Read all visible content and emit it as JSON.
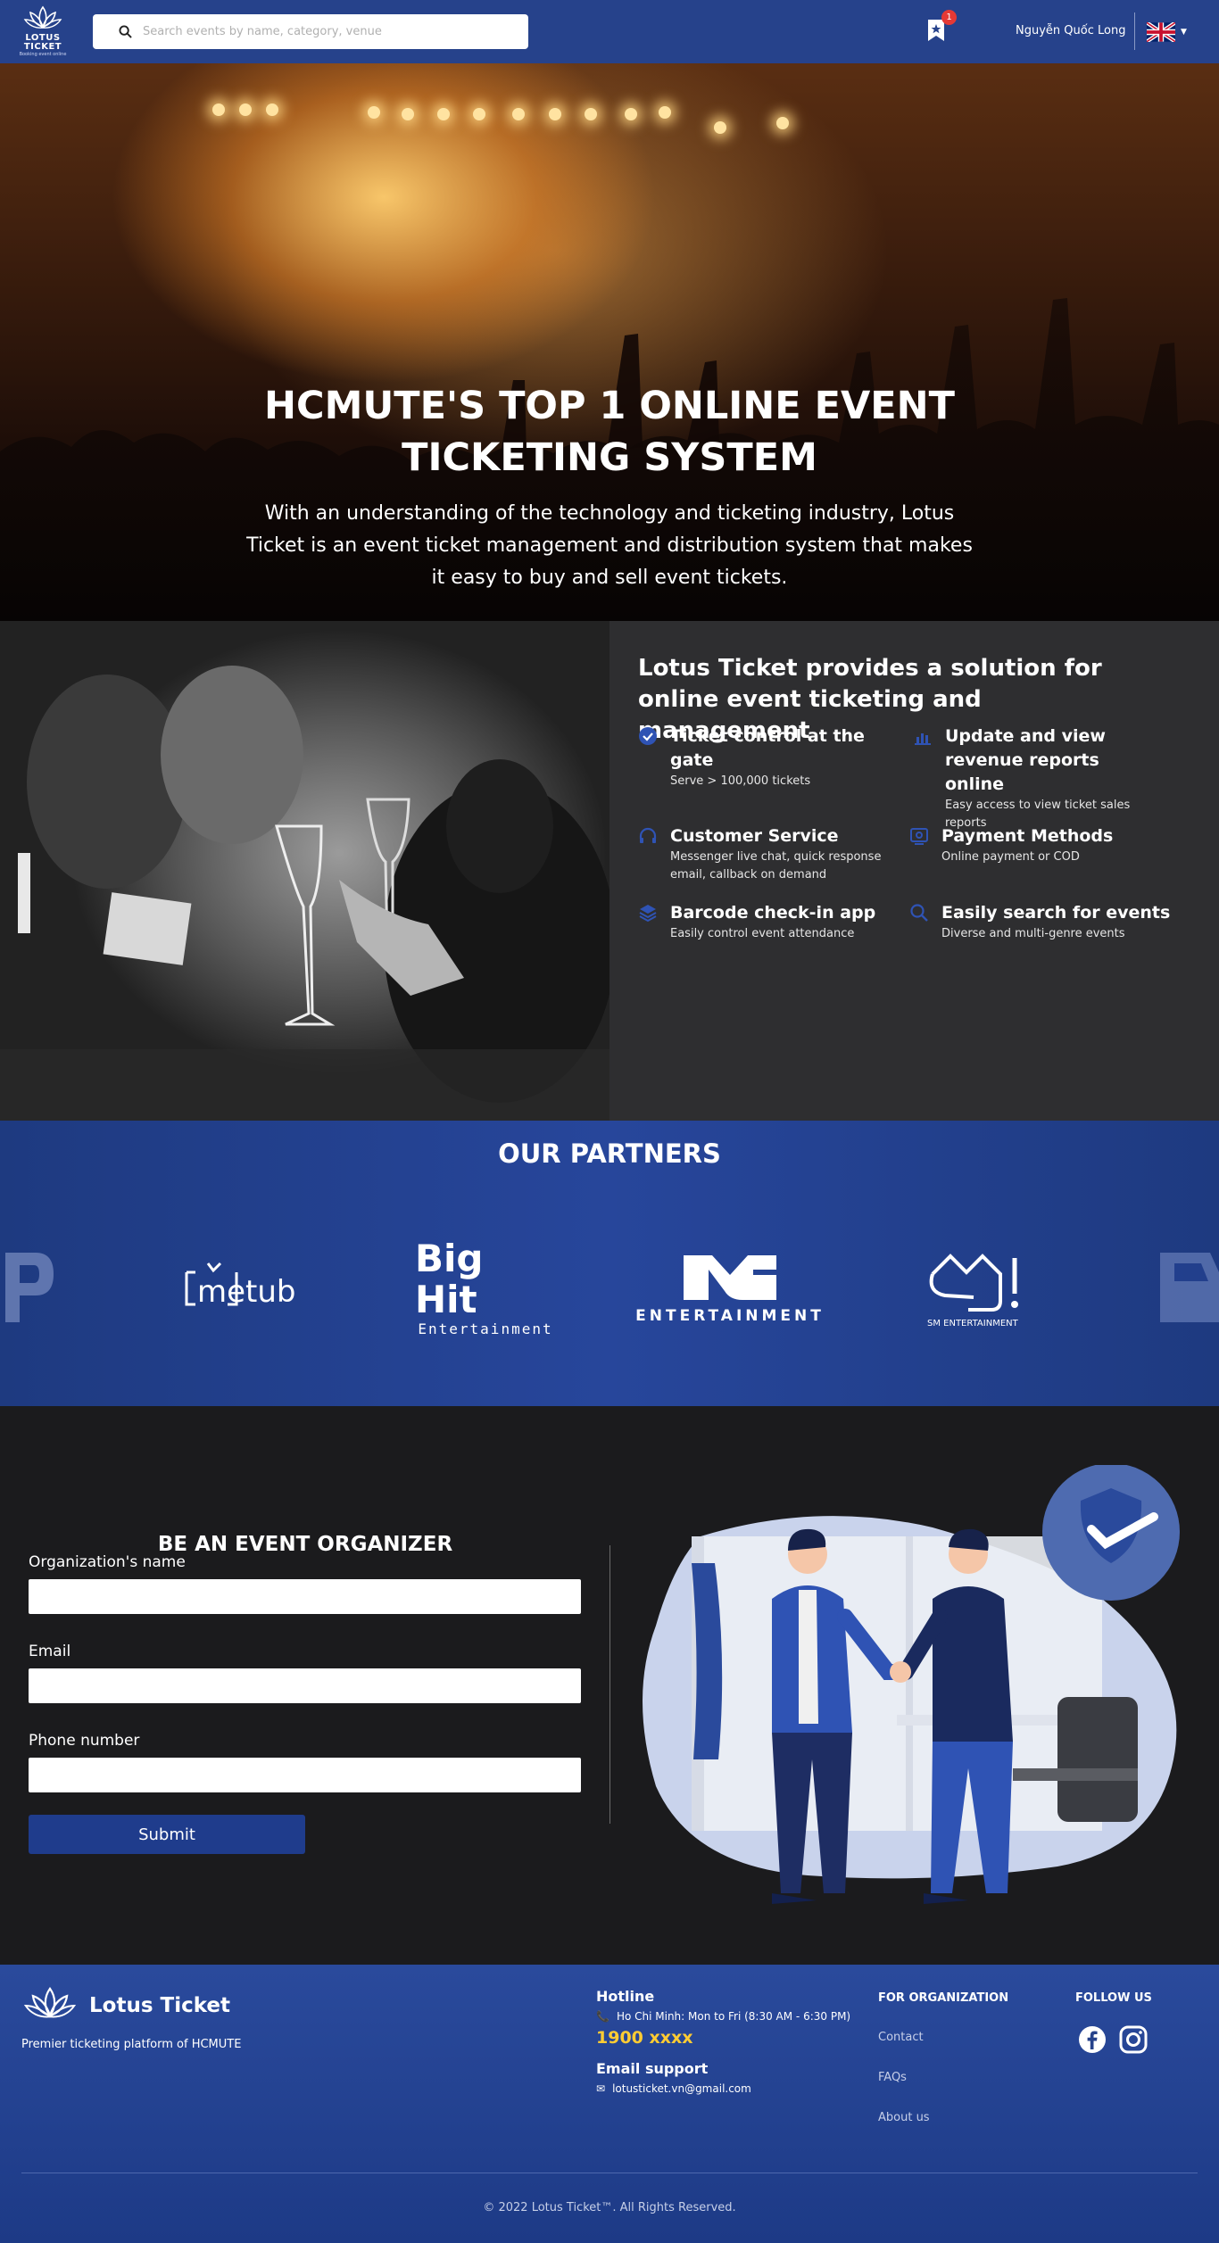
{
  "header": {
    "logo_text": "LOTUS TICKET",
    "logo_sub": "Booking event online",
    "search_placeholder": "Search events by name, category, venue",
    "cart_count": "1",
    "user_name": "Nguyễn Quốc Long",
    "language_icon": "uk-flag-icon"
  },
  "hero": {
    "title": "HCMUTE'S TOP 1 ONLINE EVENT TICKETING SYSTEM",
    "subtitle": "With an understanding of the technology and ticketing industry, Lotus Ticket is an event ticket management and distribution system that makes it easy to buy and sell event tickets."
  },
  "features": {
    "title": "Lotus Ticket provides a solution for online event ticketing and management",
    "items": [
      {
        "title": "Ticket control at the gate",
        "desc": "Serve > 100,000 tickets",
        "icon": "check-circle-icon"
      },
      {
        "title": "Update and view revenue reports online",
        "desc": "Easy access to view ticket sales reports",
        "icon": "bar-chart-icon"
      },
      {
        "title": "Customer Service",
        "desc": "Messenger live chat, quick response email, callback on demand",
        "icon": "headphones-icon"
      },
      {
        "title": "Payment Methods",
        "desc": "Online payment or COD",
        "icon": "payment-icon"
      },
      {
        "title": "Barcode check-in app",
        "desc": "Easily control event attendance",
        "icon": "layers-icon"
      },
      {
        "title": "Easily search for events",
        "desc": "Diverse and multi-genre events",
        "icon": "search-icon"
      }
    ]
  },
  "partners": {
    "title": "OUR PARTNERS",
    "logos": [
      {
        "name": "metub",
        "sub": ""
      },
      {
        "name": "Big Hit",
        "sub": "Entertainment"
      },
      {
        "name": "YG",
        "sub": "ENTERTAINMENT"
      },
      {
        "name": "SM",
        "sub": "SM ENTERTAINMENT"
      }
    ]
  },
  "organizer": {
    "title": "BE AN EVENT ORGANIZER",
    "org_label": "Organization's name",
    "email_label": "Email",
    "phone_label": "Phone number",
    "submit_label": "Submit"
  },
  "footer": {
    "brand": "Lotus Ticket",
    "tagline": "Premier ticketing platform of HCMUTE",
    "hotline_title": "Hotline",
    "hotline_hours": "Ho Chi Minh: Mon to Fri (8:30 AM - 6:30 PM)",
    "hotline_number": "1900 xxxx",
    "email_title": "Email support",
    "email": "lotusticket.vn@gmail.com",
    "org_title": "FOR ORGANIZATION",
    "links": [
      "Contact",
      "FAQs",
      "About us"
    ],
    "follow_title": "FOLLOW US",
    "copyright": "© 2022 Lotus Ticket™. All Rights Reserved."
  }
}
